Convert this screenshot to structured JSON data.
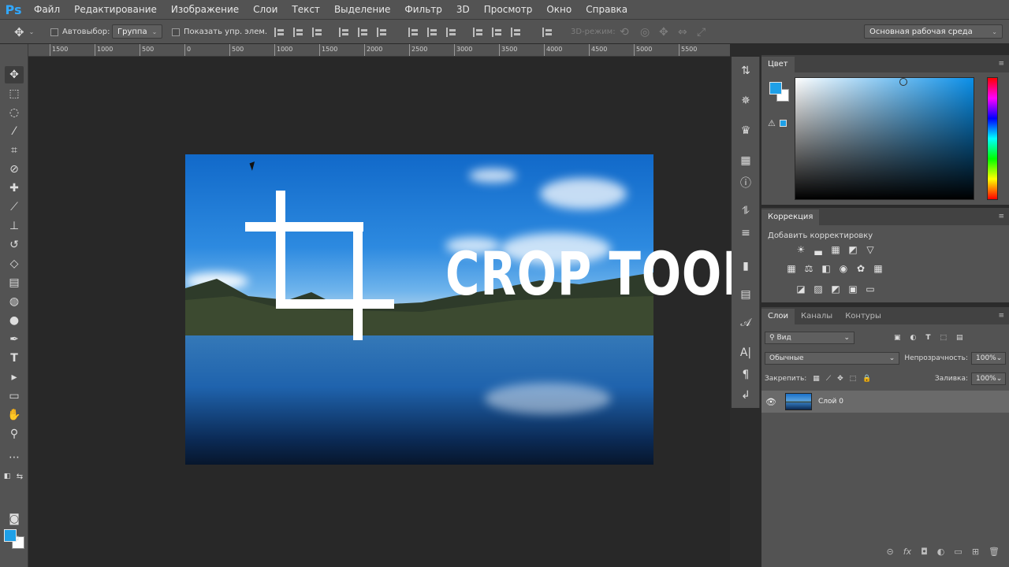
{
  "app": {
    "logo": "Ps"
  },
  "menu": [
    "Файл",
    "Редактирование",
    "Изображение",
    "Слои",
    "Текст",
    "Выделение",
    "Фильтр",
    "3D",
    "Просмотр",
    "Окно",
    "Справка"
  ],
  "options": {
    "autoselect_label": "Автовыбор:",
    "autoselect_value": "Группа",
    "show_controls_label": "Показать упр. элем.",
    "mode3d_label": "3D-режим:",
    "workspace": "Основная рабочая среда"
  },
  "ruler": [
    "1500",
    "1000",
    "500",
    "0",
    "500",
    "1000",
    "1500",
    "2000",
    "2500",
    "3000",
    "3500",
    "4000",
    "4500",
    "5000",
    "5500"
  ],
  "overlay": {
    "title": "CROP TOOL"
  },
  "panels": {
    "color": {
      "tab": "Цвет",
      "fg_color": "#1ea0e8",
      "bg_color": "#ffffff"
    },
    "adjustments": {
      "tab": "Коррекция",
      "label": "Добавить корректировку"
    },
    "layers": {
      "tabs": [
        "Слои",
        "Каналы",
        "Контуры"
      ],
      "filter_placeholder": "Вид",
      "blend_mode": "Обычные",
      "opacity_label": "Непрозрачность:",
      "opacity_value": "100%",
      "lock_label": "Закрепить:",
      "fill_label": "Заливка:",
      "fill_value": "100%",
      "layer_name": "Слой 0"
    }
  },
  "colors": {
    "accent": "#31a8ff",
    "ui_bg": "#535353",
    "canvas_bg": "#282828"
  }
}
